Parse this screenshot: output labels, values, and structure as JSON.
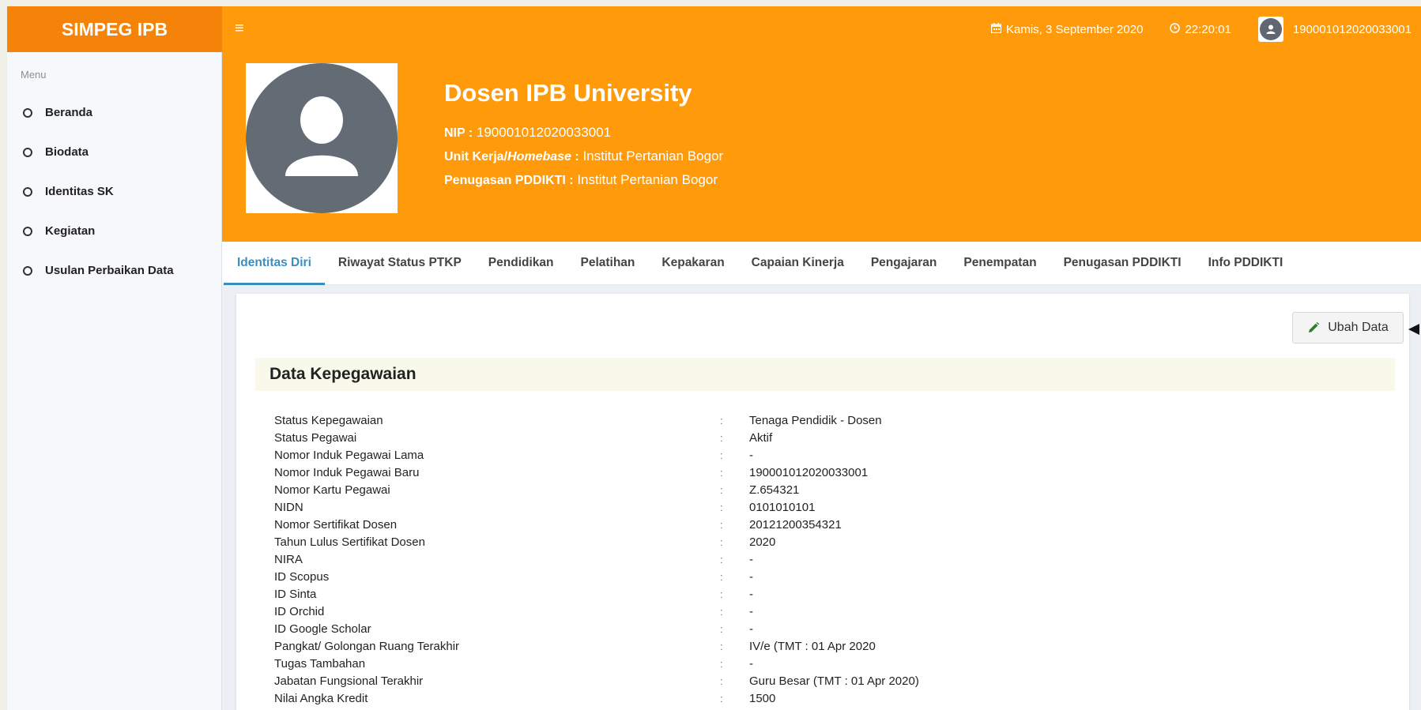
{
  "app": {
    "brand": "SIMPEG IPB"
  },
  "topbar": {
    "date": "Kamis, 3 September 2020",
    "time": "22:20:01",
    "username": "190001012020033001"
  },
  "sidebar": {
    "menu_header": "Menu",
    "items": [
      {
        "label": "Beranda"
      },
      {
        "label": "Biodata"
      },
      {
        "label": "Identitas SK"
      },
      {
        "label": "Kegiatan"
      },
      {
        "label": "Usulan Perbaikan Data"
      }
    ]
  },
  "profile": {
    "name": "Dosen IPB University",
    "nip_label": "NIP :",
    "nip_value": "190001012020033001",
    "unit_label_a": "Unit Kerja/",
    "unit_label_b": "Homebase",
    "unit_label_c": " :",
    "unit_value": "Institut Pertanian Bogor",
    "penugasan_label": "Penugasan PDDIKTI :",
    "penugasan_value": "Institut Pertanian Bogor"
  },
  "tabs": [
    {
      "label": "Identitas Diri",
      "active": true
    },
    {
      "label": "Riwayat Status PTKP"
    },
    {
      "label": "Pendidikan"
    },
    {
      "label": "Pelatihan"
    },
    {
      "label": "Kepakaran"
    },
    {
      "label": "Capaian Kinerja"
    },
    {
      "label": "Pengajaran"
    },
    {
      "label": "Penempatan"
    },
    {
      "label": "Penugasan PDDIKTI"
    },
    {
      "label": "Info PDDIKTI"
    }
  ],
  "card": {
    "edit_label": "Ubah Data",
    "section_title": "Data Kepegawaian",
    "separator": ":",
    "rows": [
      {
        "key": "Status Kepegawaian",
        "value": "Tenaga Pendidik - Dosen"
      },
      {
        "key": "Status Pegawai",
        "value": "Aktif"
      },
      {
        "key": "Nomor Induk Pegawai Lama",
        "value": "-"
      },
      {
        "key": "Nomor Induk Pegawai Baru",
        "value": "190001012020033001"
      },
      {
        "key": "Nomor Kartu Pegawai",
        "value": "Z.654321"
      },
      {
        "key": "NIDN",
        "value": "0101010101"
      },
      {
        "key": "Nomor Sertifikat Dosen",
        "value": "20121200354321"
      },
      {
        "key": "Tahun Lulus Sertifikat Dosen",
        "value": "2020"
      },
      {
        "key": "NIRA",
        "value": "-"
      },
      {
        "key": "ID Scopus",
        "value": "-"
      },
      {
        "key": "ID Sinta",
        "value": "-"
      },
      {
        "key": "ID Orchid",
        "value": "-"
      },
      {
        "key": "ID Google Scholar",
        "value": "-"
      },
      {
        "key": "Pangkat/ Golongan Ruang Terakhir",
        "value": "IV/e (TMT : 01 Apr 2020"
      },
      {
        "key": "Tugas Tambahan",
        "value": "-"
      },
      {
        "key": "Jabatan Fungsional Terakhir",
        "value": "Guru Besar (TMT : 01 Apr 2020)"
      },
      {
        "key": "Nilai Angka Kredit",
        "value": "1500"
      }
    ]
  }
}
